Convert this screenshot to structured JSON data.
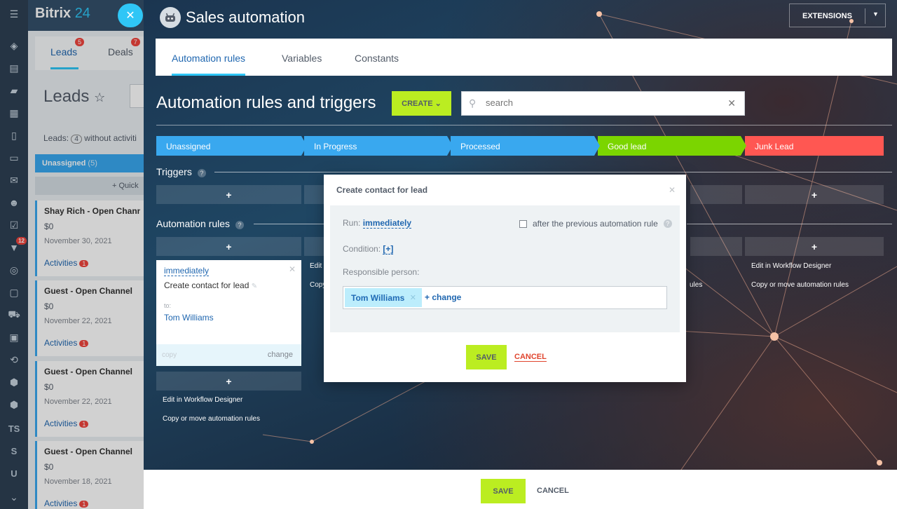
{
  "app": {
    "logo": "Bitrix",
    "logo_num": "24"
  },
  "crm": {
    "tabs": [
      {
        "label": "Leads",
        "badge": "5"
      },
      {
        "label": "Deals",
        "badge": "7"
      }
    ],
    "title": "Leads",
    "subtitle_prefix": "Leads:",
    "subtitle_count": "4",
    "subtitle_suffix": "without activiti",
    "column": {
      "label": "Unassigned",
      "count": "(5)"
    },
    "quick_add": "+ Quick",
    "cards": [
      {
        "title": "Shay Rich - Open Channel",
        "sum": "$0",
        "date": "November 30, 2021",
        "activities": "Activities",
        "badge": "1"
      },
      {
        "title": "Guest - Open Channel",
        "sum": "$0",
        "date": "November 22, 2021",
        "activities": "Activities",
        "badge": "1"
      },
      {
        "title": "Guest - Open Channel",
        "sum": "$0",
        "date": "November 22, 2021",
        "activities": "Activities",
        "badge": "1"
      },
      {
        "title": "Guest - Open Channel",
        "sum": "$0",
        "date": "November 18, 2021",
        "activities": "Activities",
        "badge": "1"
      }
    ]
  },
  "iconbar": {
    "filter_badge": "12",
    "ts": "TS",
    "s": "S",
    "u": "U"
  },
  "slider": {
    "title": "Sales automation",
    "extensions": "EXTENSIONS",
    "tabs": [
      "Automation rules",
      "Variables",
      "Constants"
    ],
    "heading": "Automation rules and triggers",
    "create": "CREATE",
    "search_placeholder": "search",
    "stages": [
      {
        "label": "Unassigned",
        "color": "#39a8ef"
      },
      {
        "label": "In Progress",
        "color": "#39a8ef"
      },
      {
        "label": "Processed",
        "color": "#39a8ef"
      },
      {
        "label": "Good lead",
        "color": "#7bd500"
      },
      {
        "label": "Junk Lead",
        "color": "#ff5752"
      }
    ],
    "triggers_label": "Triggers",
    "rules_label": "Automation rules",
    "plus": "+",
    "edit_designer": "Edit in Workflow Designer",
    "copy_move": "Copy or move automation rules",
    "edit_designer_short": "Edit i",
    "copy_short": "Copy",
    "rules_short": "ules",
    "rule_card": {
      "when": "immediately",
      "name": "Create contact for lead",
      "to_label": "to:",
      "person": "Tom Williams",
      "copy": "copy",
      "change": "change"
    },
    "save": "SAVE",
    "cancel": "CANCEL"
  },
  "dialog": {
    "title": "Create contact for lead",
    "run_label": "Run:",
    "run_value": "immediately",
    "after_previous": "after the previous automation rule",
    "condition_label": "Condition:",
    "condition_value": "[+]",
    "responsible_label": "Responsible person:",
    "responsible_value": "Tom Williams",
    "change": "+ change",
    "save": "SAVE",
    "cancel": "CANCEL"
  }
}
